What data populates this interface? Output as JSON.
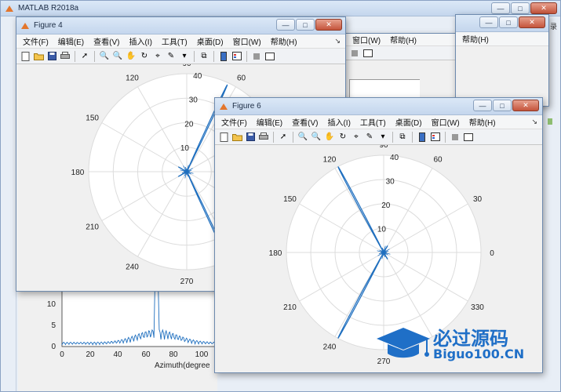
{
  "matlab": {
    "title": "MATLAB R2018a",
    "right_partial_label": "录"
  },
  "figure4": {
    "title": "Figure 4",
    "menu": [
      "文件(F)",
      "编辑(E)",
      "查看(V)",
      "插入(I)",
      "工具(T)",
      "桌面(D)",
      "窗口(W)",
      "帮助(H)"
    ],
    "angle_labels": [
      "90",
      "60",
      "120",
      "150",
      "180",
      "210",
      "240",
      "270"
    ],
    "radial_labels": [
      "40",
      "30",
      "20",
      "10"
    ]
  },
  "figure_behind": {
    "menu": [
      "窗口(W)",
      "帮助(H)"
    ]
  },
  "figure6": {
    "title": "Figure 6",
    "menu": [
      "文件(F)",
      "编辑(E)",
      "查看(V)",
      "插入(I)",
      "工具(T)",
      "桌面(D)",
      "窗口(W)",
      "帮助(H)"
    ],
    "angle_labels": [
      "90",
      "60",
      "30",
      "0",
      "330",
      "270",
      "240",
      "210",
      "180",
      "150",
      "120"
    ],
    "radial_labels": [
      "40",
      "30",
      "20",
      "10"
    ]
  },
  "bottom_plot": {
    "y_ticks": [
      "10",
      "5",
      "0"
    ],
    "x_ticks": [
      "0",
      "20",
      "40",
      "60",
      "80",
      "100"
    ],
    "xlabel": "Azimuth(degree"
  },
  "watermark": {
    "brand_cn": "必过源码",
    "brand_en": "Biguo100.CN"
  },
  "colors": {
    "plot_line": "#1f6fbf",
    "grid": "#dcdcdc",
    "axes_bg": "#ffffff"
  }
}
